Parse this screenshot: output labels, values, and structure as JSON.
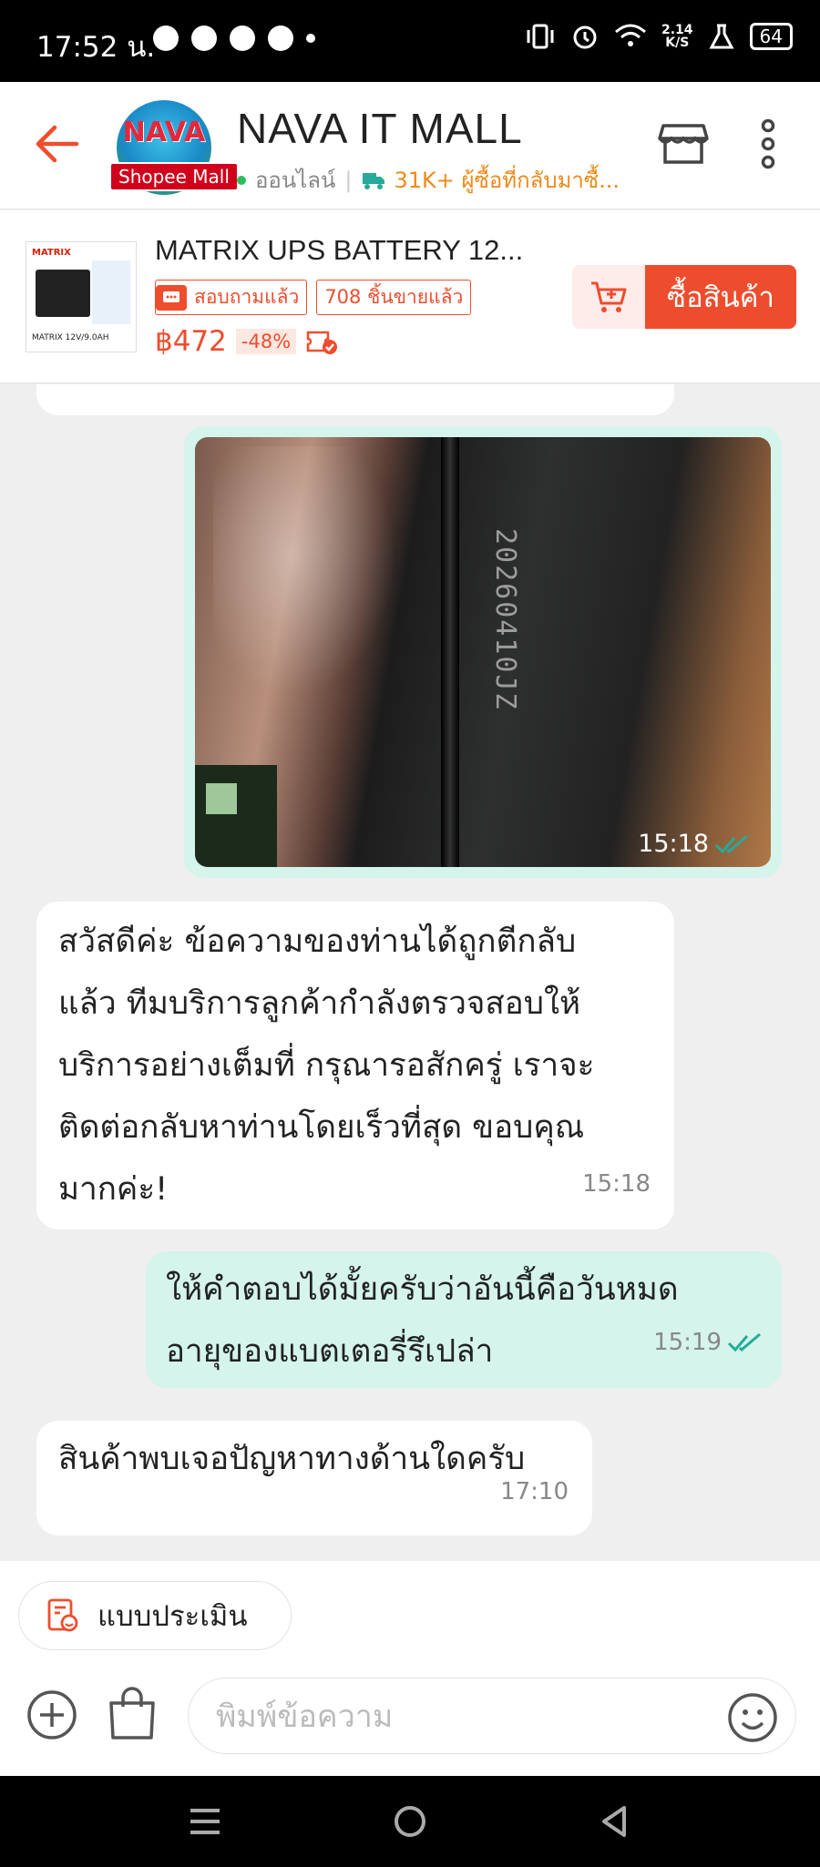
{
  "status_bar": {
    "time": "17:52 น.",
    "net_speed_value": "2.14",
    "net_speed_unit": "K/S",
    "battery": "64"
  },
  "header": {
    "shop_name": "NAVA IT MALL",
    "avatar_text": "NAVA",
    "mall_badge": "Shopee Mall",
    "online_status": "ออนไลน์",
    "returning_buyers": "31K+ ผู้ซื้อที่กลับมาซื้..."
  },
  "product": {
    "title": "MATRIX UPS BATTERY 12...",
    "tag_asked": "สอบถามแล้ว",
    "tag_sold": "708 ชิ้นขายแล้ว",
    "price": "฿472",
    "discount": "-48%",
    "buy_label": "ซื้อสินค้า",
    "thumb_brand": "MATRIX",
    "thumb_caption": "MATRIX 12V/9.0AH"
  },
  "messages": [
    {
      "type": "image",
      "direction": "out",
      "photo_text": "20260410JZ",
      "time": "15:18",
      "read": true
    },
    {
      "type": "text",
      "direction": "in",
      "lines": [
        "สวัสดีค่ะ ข้อความของท่านได้ถูกตีกลับ",
        "แล้ว ทีมบริการลูกค้ากำลังตรวจสอบให้",
        "บริการอย่างเต็มที่ กรุณารอสักครู่ เราจะ",
        "ติดต่อกลับหาท่านโดยเร็วที่สุด ขอบคุณ",
        "มากค่ะ!"
      ],
      "time": "15:18"
    },
    {
      "type": "text",
      "direction": "out",
      "lines": [
        "ให้คำตอบได้มั้ยครับว่าอันนี้คือวันหมด",
        "อายุของแบตเตอรี่รึเปล่า"
      ],
      "time": "15:19",
      "read": true
    },
    {
      "type": "text",
      "direction": "in",
      "lines": [
        "สินค้าพบเจอปัญหาทางด้านใดครับ"
      ],
      "time": "17:10"
    }
  ],
  "bottom": {
    "rate_label": "แบบประเมิน",
    "input_placeholder": "พิมพ์ข้อความ"
  },
  "colors": {
    "accent": "#ee4d2d",
    "bubble_out": "#d4f4ec",
    "online": "#2dbb5d",
    "read_tick": "#26aa99"
  }
}
